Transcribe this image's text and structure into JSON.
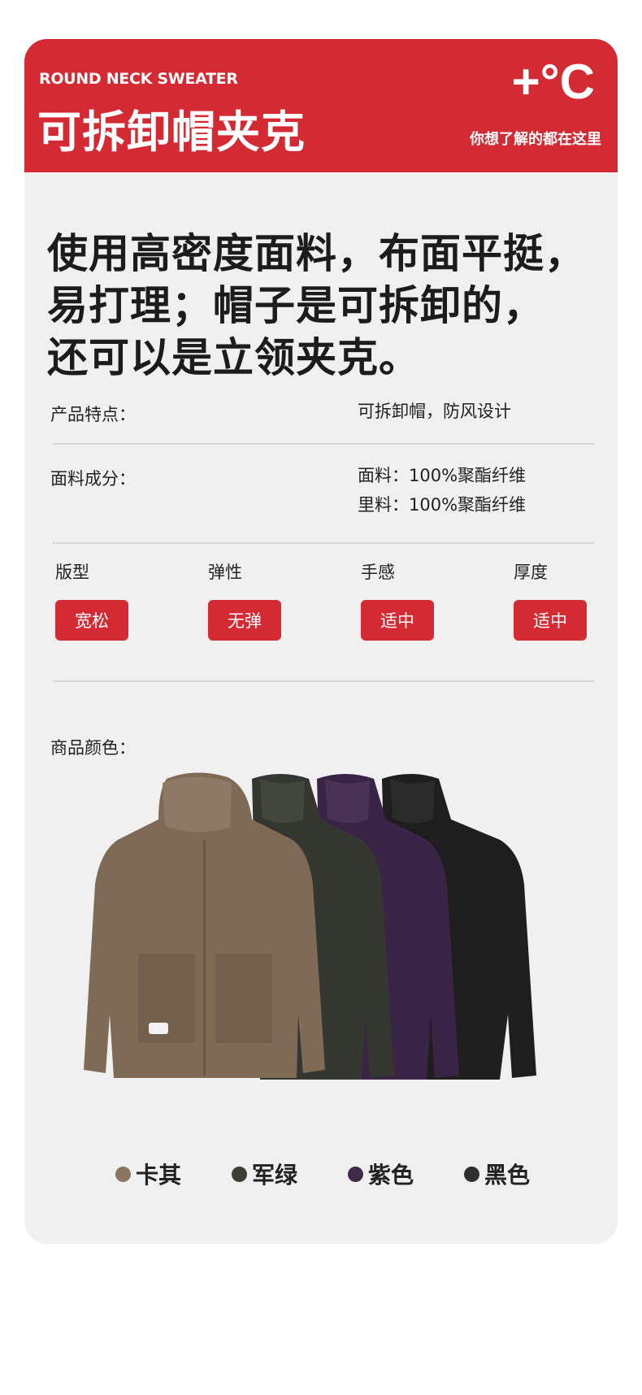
{
  "header": {
    "subtitle": "ROUND NECK SWEATER",
    "title": "可拆卸帽夹克",
    "badge": "+°C",
    "tagline": "你想了解的都在这里"
  },
  "headline": {
    "lines": [
      "使用高密度面料，布面平挺，",
      "易打理；帽子是可拆卸的，",
      "还可以是立领夹克。"
    ]
  },
  "features": {
    "label": "产品特点：",
    "value": "可拆卸帽，防风设计"
  },
  "fabric": {
    "label": "面料成分：",
    "outer": "面料：100%聚酯纤维",
    "lining": "里料：100%聚酯纤维"
  },
  "attributes": [
    {
      "label": "版型",
      "value": "宽松"
    },
    {
      "label": "弹性",
      "value": "无弹"
    },
    {
      "label": "手感",
      "value": "适中"
    },
    {
      "label": "厚度",
      "value": "适中"
    }
  ],
  "colors": {
    "label": "商品颜色：",
    "options": [
      {
        "name": "卡其",
        "hex": "#8a7560"
      },
      {
        "name": "军绿",
        "hex": "#3b4035"
      },
      {
        "name": "紫色",
        "hex": "#3f2a48"
      },
      {
        "name": "黑色",
        "hex": "#2f2f2f"
      }
    ]
  },
  "accent_color": "#d42a33"
}
